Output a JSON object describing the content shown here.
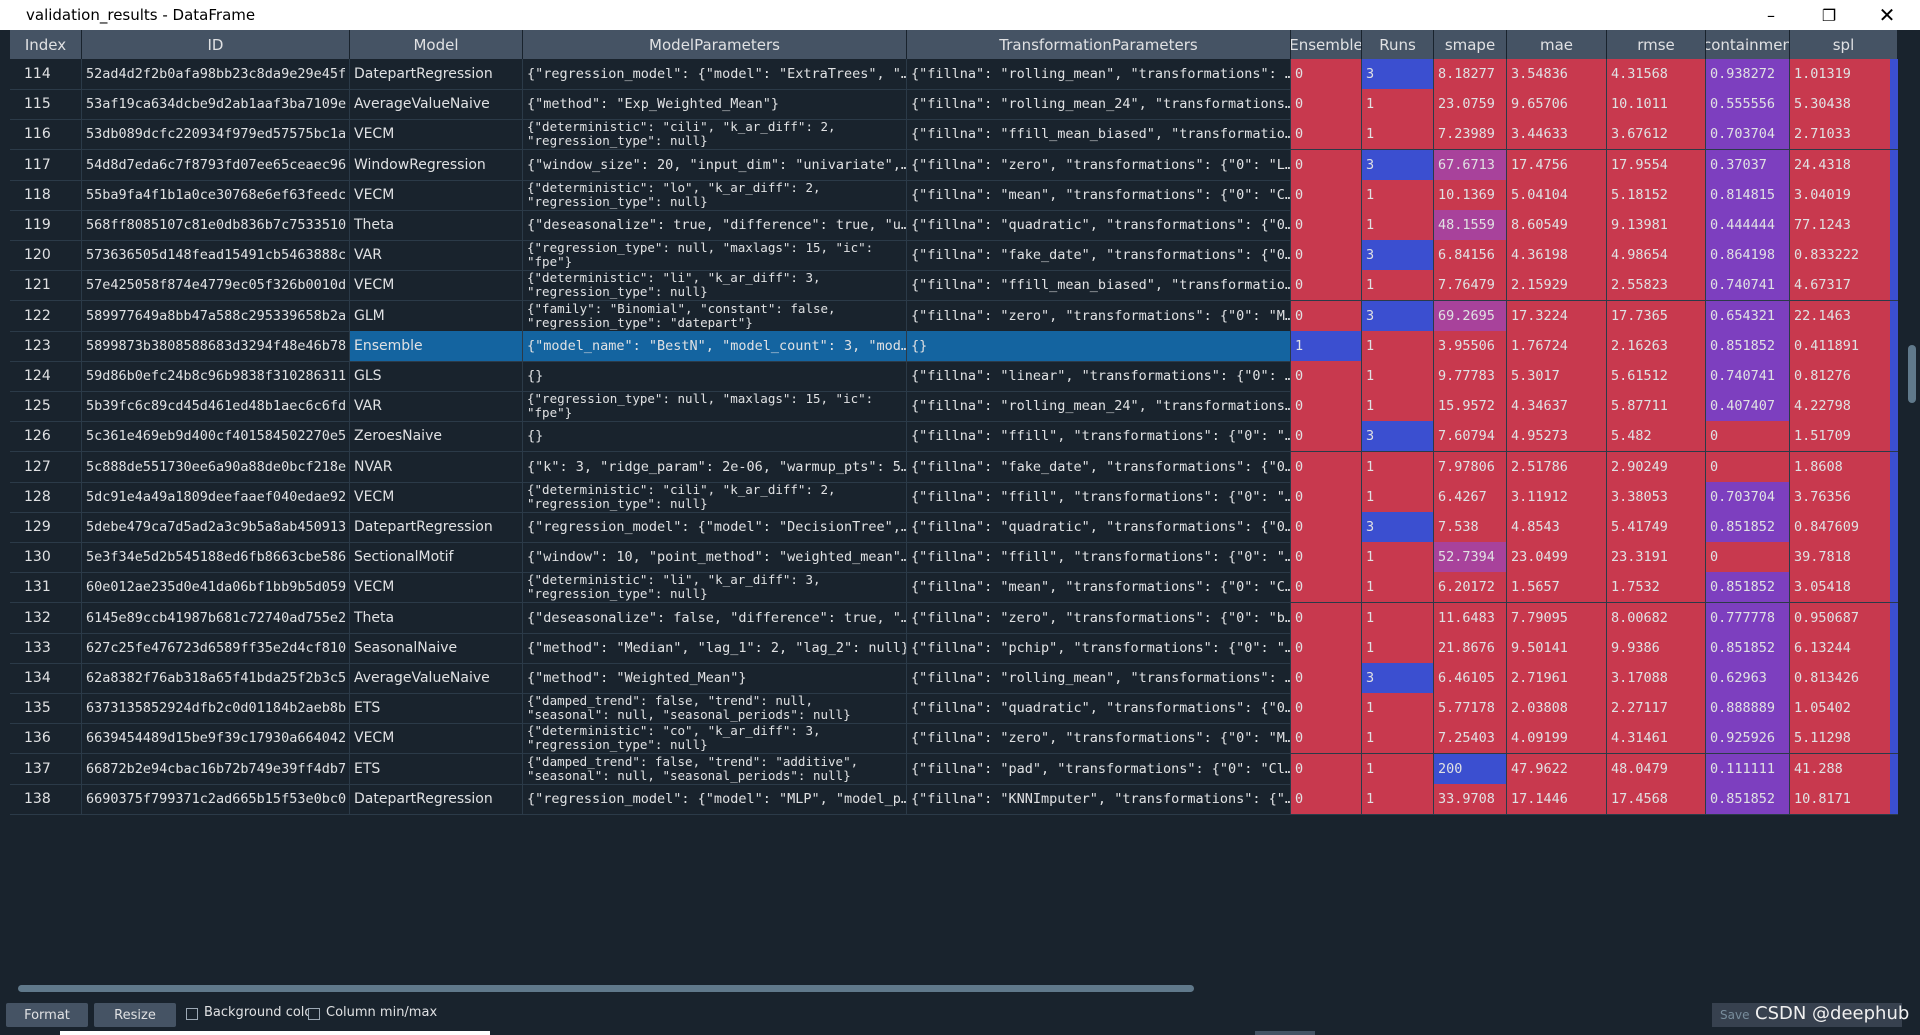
{
  "window": {
    "title": "validation_results - DataFrame"
  },
  "columns": [
    "Index",
    "ID",
    "Model",
    "ModelParameters",
    "TransformationParameters",
    "Ensemble",
    "Runs",
    "smape",
    "mae",
    "rmse",
    "containmen",
    "spl"
  ],
  "colors": {
    "red": "#c8394e",
    "blue": "#3b4fd0",
    "purple": "#7d3fbf",
    "pink": "#a8429b",
    "selection": "#1464a0"
  },
  "rows": [
    {
      "idx": "114",
      "id": "52ad4d2f2b0afa98bb23c8da9e29e45f",
      "model": "DatepartRegression",
      "mp": "{\"regression_model\": {\"model\": \"ExtraTrees\", \"…",
      "tp": "{\"fillna\": \"rolling_mean\", \"transformations\": …",
      "ens": "0",
      "runs": "3",
      "smape": "8.18277",
      "mae": "3.54836",
      "rmse": "4.31568",
      "cont": "0.938272",
      "spl": "1.01319"
    },
    {
      "idx": "115",
      "id": "53af19ca634dcbe9d2ab1aaf3ba7109e",
      "model": "AverageValueNaive",
      "mp": "{\"method\": \"Exp_Weighted_Mean\"}",
      "tp": "{\"fillna\": \"rolling_mean_24\", \"transformations…",
      "ens": "0",
      "runs": "1",
      "smape": "23.0759",
      "mae": "9.65706",
      "rmse": "10.1011",
      "cont": "0.555556",
      "spl": "5.30438"
    },
    {
      "idx": "116",
      "id": "53db089dcfc220934f979ed57575bc1a",
      "model": "VECM",
      "mp": "{\"deterministic\": \"cili\", \"k_ar_diff\": 2,\n\"regression_type\": null}",
      "tp": "{\"fillna\": \"ffill_mean_biased\", \"transformatio…",
      "ens": "0",
      "runs": "1",
      "smape": "7.23989",
      "mae": "3.44633",
      "rmse": "3.67612",
      "cont": "0.703704",
      "spl": "2.71033"
    },
    {
      "idx": "117",
      "id": "54d8d7eda6c7f8793fd07ee65ceaec96",
      "model": "WindowRegression",
      "mp": "{\"window_size\": 20, \"input_dim\": \"univariate\",…",
      "tp": "{\"fillna\": \"zero\", \"transformations\": {\"0\": \"L…",
      "ens": "0",
      "runs": "3",
      "smape": "67.6713",
      "mae": "17.4756",
      "rmse": "17.9554",
      "cont": "0.37037",
      "spl": "24.4318"
    },
    {
      "idx": "118",
      "id": "55ba9fa4f1b1a0ce30768e6ef63feedc",
      "model": "VECM",
      "mp": "{\"deterministic\": \"lo\", \"k_ar_diff\": 2,\n\"regression_type\": null}",
      "tp": "{\"fillna\": \"mean\", \"transformations\": {\"0\": \"C…",
      "ens": "0",
      "runs": "1",
      "smape": "10.1369",
      "mae": "5.04104",
      "rmse": "5.18152",
      "cont": "0.814815",
      "spl": "3.04019"
    },
    {
      "idx": "119",
      "id": "568ff8085107c81e0db836b7c7533510",
      "model": "Theta",
      "mp": "{\"deseasonalize\": true, \"difference\": true, \"u…",
      "tp": "{\"fillna\": \"quadratic\", \"transformations\": {\"0…",
      "ens": "0",
      "runs": "1",
      "smape": "48.1559",
      "mae": "8.60549",
      "rmse": "9.13981",
      "cont": "0.444444",
      "spl": "77.1243"
    },
    {
      "idx": "120",
      "id": "573636505d148fead15491cb5463888c",
      "model": "VAR",
      "mp": "{\"regression_type\": null, \"maxlags\": 15, \"ic\":\n\"fpe\"}",
      "tp": "{\"fillna\": \"fake_date\", \"transformations\": {\"0…",
      "ens": "0",
      "runs": "3",
      "smape": "6.84156",
      "mae": "4.36198",
      "rmse": "4.98654",
      "cont": "0.864198",
      "spl": "0.833222"
    },
    {
      "idx": "121",
      "id": "57e425058f874e4779ec05f326b0010d",
      "model": "VECM",
      "mp": "{\"deterministic\": \"li\", \"k_ar_diff\": 3,\n\"regression_type\": null}",
      "tp": "{\"fillna\": \"ffill_mean_biased\", \"transformatio…",
      "ens": "0",
      "runs": "1",
      "smape": "7.76479",
      "mae": "2.15929",
      "rmse": "2.55823",
      "cont": "0.740741",
      "spl": "4.67317"
    },
    {
      "idx": "122",
      "id": "589977649a8bb47a588c295339658b2a",
      "model": "GLM",
      "mp": "{\"family\": \"Binomial\", \"constant\": false,\n\"regression_type\": \"datepart\"}",
      "tp": "{\"fillna\": \"zero\", \"transformations\": {\"0\": \"M…",
      "ens": "0",
      "runs": "3",
      "smape": "69.2695",
      "mae": "17.3224",
      "rmse": "17.7365",
      "cont": "0.654321",
      "spl": "22.1463"
    },
    {
      "idx": "123",
      "id": "5899873b3808588683d3294f48e46b78",
      "model": "Ensemble",
      "mp": "{\"model_name\": \"BestN\", \"model_count\": 3, \"mod…",
      "tp": "{}",
      "ens": "1",
      "runs": "1",
      "smape": "3.95506",
      "mae": "1.76724",
      "rmse": "2.16263",
      "cont": "0.851852",
      "spl": "0.411891",
      "selected": true
    },
    {
      "idx": "124",
      "id": "59d86b0efc24b8c96b9838f310286311",
      "model": "GLS",
      "mp": "{}",
      "tp": "{\"fillna\": \"linear\", \"transformations\": {\"0\": …",
      "ens": "0",
      "runs": "1",
      "smape": "9.77783",
      "mae": "5.3017",
      "rmse": "5.61512",
      "cont": "0.740741",
      "spl": "0.81276"
    },
    {
      "idx": "125",
      "id": "5b39fc6c89cd45d461ed48b1aec6c6fd",
      "model": "VAR",
      "mp": "{\"regression_type\": null, \"maxlags\": 15, \"ic\":\n\"fpe\"}",
      "tp": "{\"fillna\": \"rolling_mean_24\", \"transformations…",
      "ens": "0",
      "runs": "1",
      "smape": "15.9572",
      "mae": "4.34637",
      "rmse": "5.87711",
      "cont": "0.407407",
      "spl": "4.22798"
    },
    {
      "idx": "126",
      "id": "5c361e469eb9d400cf401584502270e5",
      "model": "ZeroesNaive",
      "mp": "{}",
      "tp": "{\"fillna\": \"ffill\", \"transformations\": {\"0\": \"…",
      "ens": "0",
      "runs": "3",
      "smape": "7.60794",
      "mae": "4.95273",
      "rmse": "5.482",
      "cont": "0",
      "spl": "1.51709"
    },
    {
      "idx": "127",
      "id": "5c888de551730ee6a90a88de0bcf218e",
      "model": "NVAR",
      "mp": "{\"k\": 3, \"ridge_param\": 2e-06, \"warmup_pts\": 5…",
      "tp": "{\"fillna\": \"fake_date\", \"transformations\": {\"0…",
      "ens": "0",
      "runs": "1",
      "smape": "7.97806",
      "mae": "2.51786",
      "rmse": "2.90249",
      "cont": "0",
      "spl": "1.8608"
    },
    {
      "idx": "128",
      "id": "5dc91e4a49a1809deefaaef040edae92",
      "model": "VECM",
      "mp": "{\"deterministic\": \"cili\", \"k_ar_diff\": 2,\n\"regression_type\": null}",
      "tp": "{\"fillna\": \"ffill\", \"transformations\": {\"0\": \"…",
      "ens": "0",
      "runs": "1",
      "smape": "6.4267",
      "mae": "3.11912",
      "rmse": "3.38053",
      "cont": "0.703704",
      "spl": "3.76356"
    },
    {
      "idx": "129",
      "id": "5debe479ca7d5ad2a3c9b5a8ab450913",
      "model": "DatepartRegression",
      "mp": "{\"regression_model\": {\"model\": \"DecisionTree\",…",
      "tp": "{\"fillna\": \"quadratic\", \"transformations\": {\"0…",
      "ens": "0",
      "runs": "3",
      "smape": "7.538",
      "mae": "4.8543",
      "rmse": "5.41749",
      "cont": "0.851852",
      "spl": "0.847609"
    },
    {
      "idx": "130",
      "id": "5e3f34e5d2b545188ed6fb8663cbe586",
      "model": "SectionalMotif",
      "mp": "{\"window\": 10, \"point_method\": \"weighted_mean\"…",
      "tp": "{\"fillna\": \"ffill\", \"transformations\": {\"0\": \"…",
      "ens": "0",
      "runs": "1",
      "smape": "52.7394",
      "mae": "23.0499",
      "rmse": "23.3191",
      "cont": "0",
      "spl": "39.7818"
    },
    {
      "idx": "131",
      "id": "60e012ae235d0e41da06bf1bb9b5d059",
      "model": "VECM",
      "mp": "{\"deterministic\": \"li\", \"k_ar_diff\": 3,\n\"regression_type\": null}",
      "tp": "{\"fillna\": \"mean\", \"transformations\": {\"0\": \"C…",
      "ens": "0",
      "runs": "1",
      "smape": "6.20172",
      "mae": "1.5657",
      "rmse": "1.7532",
      "cont": "0.851852",
      "spl": "3.05418"
    },
    {
      "idx": "132",
      "id": "6145e89ccb41987b681c72740ad755e2",
      "model": "Theta",
      "mp": "{\"deseasonalize\": false, \"difference\": true, \"…",
      "tp": "{\"fillna\": \"zero\", \"transformations\": {\"0\": \"b…",
      "ens": "0",
      "runs": "1",
      "smape": "11.6483",
      "mae": "7.79095",
      "rmse": "8.00682",
      "cont": "0.777778",
      "spl": "0.950687"
    },
    {
      "idx": "133",
      "id": "627c25fe476723d6589ff35e2d4cf810",
      "model": "SeasonalNaive",
      "mp": "{\"method\": \"Median\", \"lag_1\": 2, \"lag_2\": null}",
      "tp": "{\"fillna\": \"pchip\", \"transformations\": {\"0\": \"…",
      "ens": "0",
      "runs": "1",
      "smape": "21.8676",
      "mae": "9.50141",
      "rmse": "9.9386",
      "cont": "0.851852",
      "spl": "6.13244"
    },
    {
      "idx": "134",
      "id": "62a8382f76ab318a65f41bda25f2b3c5",
      "model": "AverageValueNaive",
      "mp": "{\"method\": \"Weighted_Mean\"}",
      "tp": "{\"fillna\": \"rolling_mean\", \"transformations\": …",
      "ens": "0",
      "runs": "3",
      "smape": "6.46105",
      "mae": "2.71961",
      "rmse": "3.17088",
      "cont": "0.62963",
      "spl": "0.813426"
    },
    {
      "idx": "135",
      "id": "6373135852924dfb2c0d01184b2aeb8b",
      "model": "ETS",
      "mp": "{\"damped_trend\": false, \"trend\": null,\n\"seasonal\": null, \"seasonal_periods\": null}",
      "tp": "{\"fillna\": \"quadratic\", \"transformations\": {\"0…",
      "ens": "0",
      "runs": "1",
      "smape": "5.77178",
      "mae": "2.03808",
      "rmse": "2.27117",
      "cont": "0.888889",
      "spl": "1.05402"
    },
    {
      "idx": "136",
      "id": "6639454489d15be9f39c17930a664042",
      "model": "VECM",
      "mp": "{\"deterministic\": \"co\", \"k_ar_diff\": 3,\n\"regression_type\": null}",
      "tp": "{\"fillna\": \"zero\", \"transformations\": {\"0\": \"M…",
      "ens": "0",
      "runs": "1",
      "smape": "7.25403",
      "mae": "4.09199",
      "rmse": "4.31461",
      "cont": "0.925926",
      "spl": "5.11298"
    },
    {
      "idx": "137",
      "id": "66872b2e94cbac16b72b749e39ff4db7",
      "model": "ETS",
      "mp": "{\"damped_trend\": false, \"trend\": \"additive\",\n\"seasonal\": null, \"seasonal_periods\": null}",
      "tp": "{\"fillna\": \"pad\", \"transformations\": {\"0\": \"Cl…",
      "ens": "0",
      "runs": "1",
      "smape": "200",
      "mae": "47.9622",
      "rmse": "48.0479",
      "cont": "0.111111",
      "spl": "41.288"
    },
    {
      "idx": "138",
      "id": "6690375f799371c2ad665b15f53e0bc0",
      "model": "DatepartRegression",
      "mp": "{\"regression_model\": {\"model\": \"MLP\", \"model_p…",
      "tp": "{\"fillna\": \"KNNImputer\", \"transformations\": {\"…",
      "ens": "0",
      "runs": "1",
      "smape": "33.9708",
      "mae": "17.1446",
      "rmse": "17.4568",
      "cont": "0.851852",
      "spl": "10.8171"
    }
  ],
  "bottom": {
    "format_label": "Format",
    "resize_label": "Resize",
    "bg_color_label": "Background color",
    "minmax_label": "Column min/max",
    "save_label": "Save",
    "watermark": "CSDN @deephub"
  }
}
